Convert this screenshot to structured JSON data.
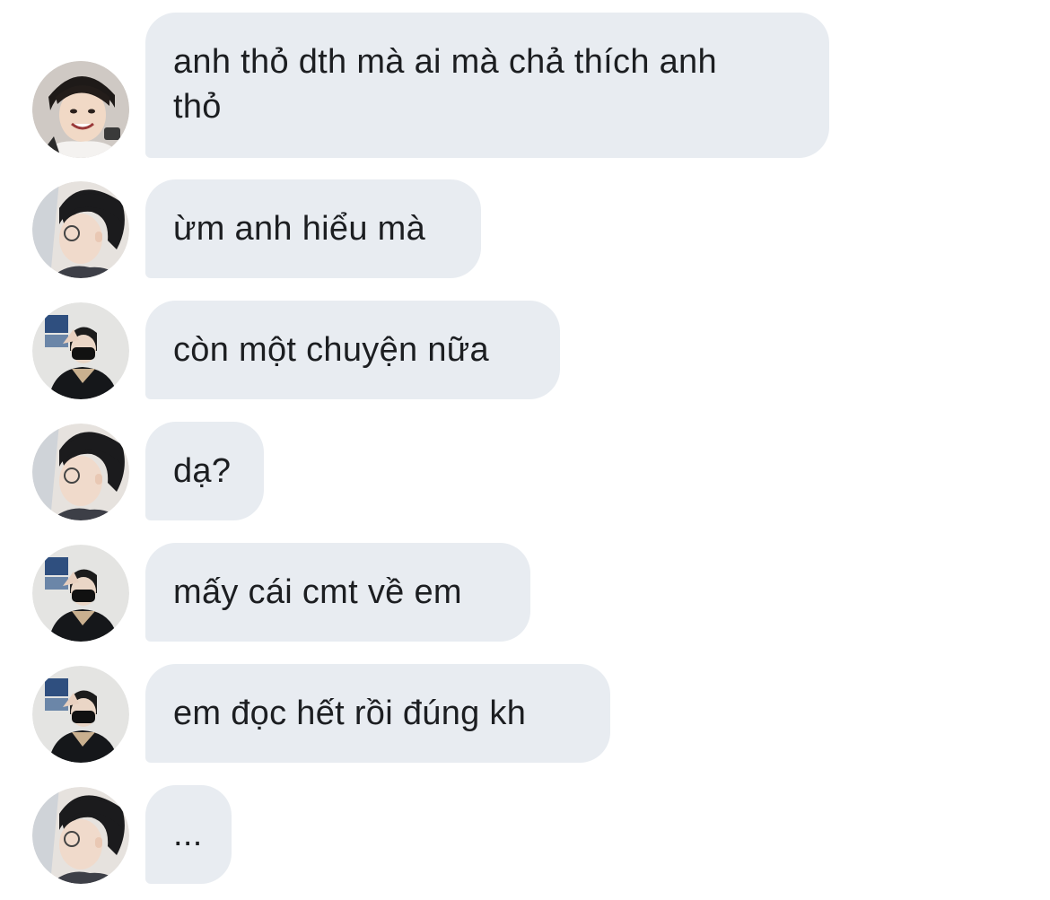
{
  "conversation": {
    "messages": [
      {
        "sender": "avatar-a",
        "text": "anh thỏ dth mà ai mà chả thích anh\nthỏ"
      },
      {
        "sender": "avatar-b",
        "text": "ừm anh hiểu mà"
      },
      {
        "sender": "avatar-c",
        "text": "còn một chuyện nữa"
      },
      {
        "sender": "avatar-b",
        "text": "dạ?"
      },
      {
        "sender": "avatar-c",
        "text": "mấy cái cmt về em"
      },
      {
        "sender": "avatar-c",
        "text": "em đọc hết rồi đúng kh"
      },
      {
        "sender": "avatar-b",
        "text": "..."
      }
    ]
  },
  "colors": {
    "bubble_background": "#e8ecf1",
    "text": "#1c1e21",
    "page_background": "#ffffff"
  }
}
